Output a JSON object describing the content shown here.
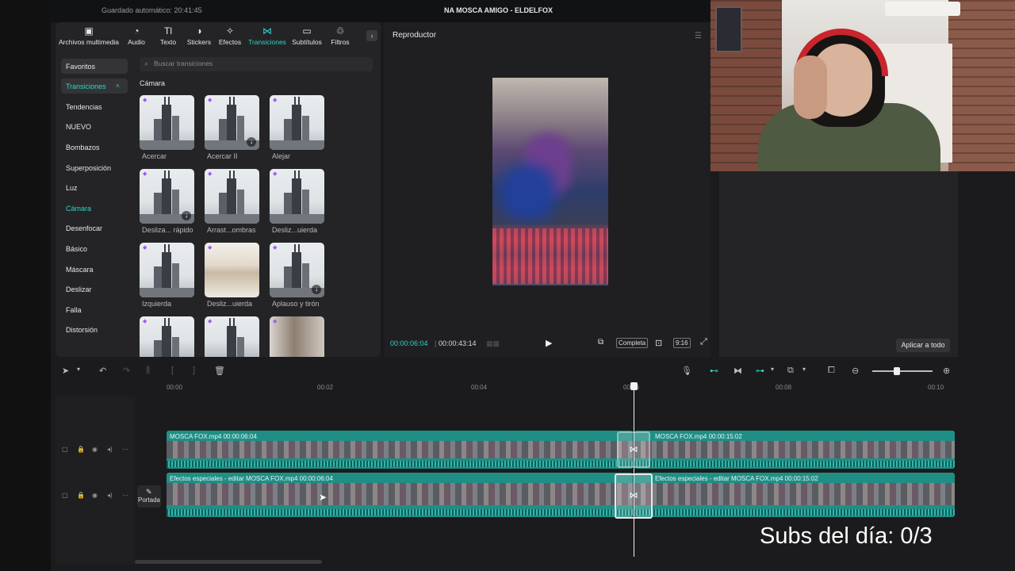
{
  "window": {
    "saved_status": "Guardado automático: 20:41:45",
    "project_title": "NA MOSCA AMIGO - ELDELFOX"
  },
  "toolbar_tabs": [
    {
      "label": "Archivos multimedia",
      "icon": "media-icon"
    },
    {
      "label": "Audio",
      "icon": "audio-icon"
    },
    {
      "label": "Texto",
      "icon": "text-icon"
    },
    {
      "label": "Stickers",
      "icon": "stickers-icon"
    },
    {
      "label": "Efectos",
      "icon": "effects-icon"
    },
    {
      "label": "Transiciones",
      "icon": "transitions-icon"
    },
    {
      "label": "Subtítulos",
      "icon": "subtitles-icon"
    },
    {
      "label": "Filtros",
      "icon": "filters-icon"
    }
  ],
  "sidebar": {
    "favorites": "Favoritos",
    "transitions": "Transiciones",
    "items": [
      "Tendencias",
      "NUEVO",
      "Bombazos",
      "Superposición",
      "Luz",
      "Cámara",
      "Desenfocar",
      "Básico",
      "Máscara",
      "Deslizar",
      "Falla",
      "Distorsión"
    ]
  },
  "search": {
    "placeholder": "Buscar transiciones"
  },
  "section": {
    "title": "Cámara"
  },
  "transitions_grid": [
    {
      "label": "Acercar"
    },
    {
      "label": "Acercar II"
    },
    {
      "label": "Alejar"
    },
    {
      "label": "Desliza... rápido"
    },
    {
      "label": "Arrast...ombras"
    },
    {
      "label": "Desliz...uierda"
    },
    {
      "label": "Izquierda"
    },
    {
      "label": "Desliz...uierda"
    },
    {
      "label": "Aplauso y tirón"
    }
  ],
  "player": {
    "title": "Reproductor",
    "current_time": "00:00:06:04",
    "total_time": "00:00:43:14",
    "full_label": "Completa",
    "ratio_label": "9:16"
  },
  "right_panel": {
    "apply_all": "Aplicar a todo"
  },
  "ruler": {
    "labels": [
      "00:00",
      "00:02",
      "00:04",
      "00:06",
      "00:08",
      "00:10"
    ]
  },
  "tracks": {
    "top_left": "MOSCA FOX.mp4   00:00:06:04",
    "top_right": "MOSCA FOX.mp4   00:00:15:02",
    "bottom_left": "Efectos especiales - editar   MOSCA FOX.mp4   00:00:06:04",
    "bottom_right": "Efectos especiales - editar   MOSCA FOX.mp4   00:00:15:02",
    "cover_label": "Portada"
  },
  "overlay": {
    "subs_text": "Subs del día: 0/3"
  },
  "colors": {
    "accent": "#2dd4c4",
    "track": "#1f8f86"
  }
}
